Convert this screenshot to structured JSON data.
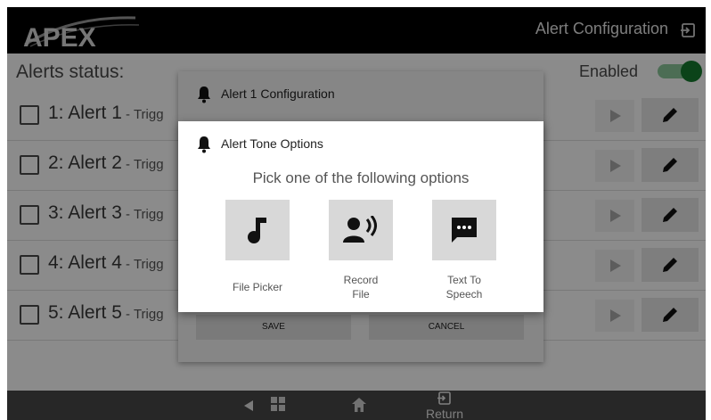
{
  "header": {
    "brand": "APEX",
    "title": "Alert Configuration",
    "exit_icon": "exit-icon"
  },
  "status": {
    "label": "Alerts status:",
    "state_label": "Enabled",
    "enabled": true,
    "toggle_color": "#157a2e"
  },
  "alerts": [
    {
      "label": "1: Alert 1",
      "suffix": " - Trigg"
    },
    {
      "label": "2: Alert 2",
      "suffix": " - Trigg"
    },
    {
      "label": "3: Alert 3",
      "suffix": " - Trigg"
    },
    {
      "label": "4: Alert 4",
      "suffix": " - Trigg"
    },
    {
      "label": "5: Alert 5",
      "suffix": " - Trigg"
    }
  ],
  "config_dialog": {
    "title": "Alert 1 Configuration",
    "save_label": "SAVE",
    "cancel_label": "CANCEL"
  },
  "tone_dialog": {
    "title": "Alert Tone Options",
    "prompt": "Pick one of the following options",
    "options": [
      {
        "label": "File Picker",
        "icon": "music-note-icon"
      },
      {
        "label": "Record\nFile",
        "icon": "record-voice-icon"
      },
      {
        "label": "Text To\nSpeech",
        "icon": "text-message-icon"
      }
    ]
  },
  "bottom_nav": {
    "return_label": "Return"
  }
}
